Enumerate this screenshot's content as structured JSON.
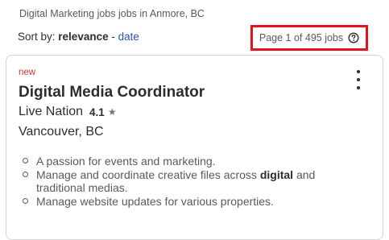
{
  "header": {
    "breadcrumb": "Digital Marketing jobs jobs in Anmore, BC",
    "sort_label": "Sort by:",
    "sort_active": "relevance",
    "sort_separator": "-",
    "sort_alt": "date",
    "page_count": "Page 1 of 495 jobs",
    "help_icon": "question-circle-icon"
  },
  "job": {
    "tag": "new",
    "title": "Digital Media Coordinator",
    "company": "Live Nation",
    "rating": "4.1",
    "rating_icon": "star-icon",
    "location": "Vancouver, BC",
    "menu_icon": "kebab-menu-icon",
    "snippet": [
      {
        "before": "A passion for events and marketing.",
        "bold": "",
        "after": ""
      },
      {
        "before": "Manage and coordinate creative files across ",
        "bold": "digital",
        "after": " and traditional medias."
      },
      {
        "before": "Manage website updates for various properties.",
        "bold": "",
        "after": ""
      }
    ]
  },
  "colors": {
    "highlight_border": "#e8121f",
    "link": "#2557a7",
    "new_tag": "#d5332b"
  }
}
